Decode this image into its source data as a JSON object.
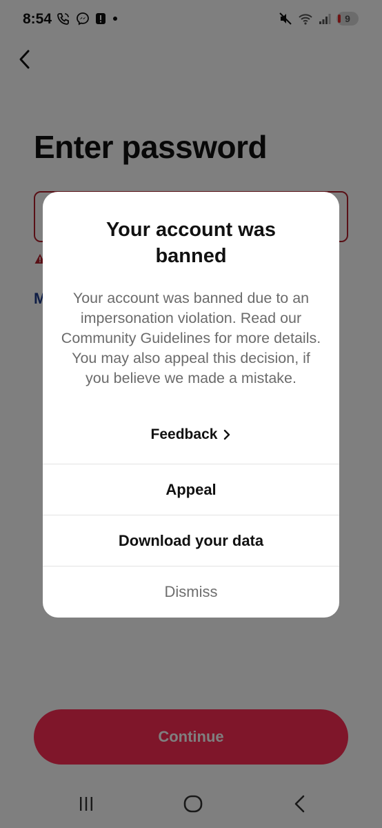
{
  "status_bar": {
    "time": "8:54",
    "battery": "9"
  },
  "page": {
    "title": "Enter password",
    "link_stub": "M",
    "continue_label": "Continue"
  },
  "modal": {
    "title_line1": "Your account was",
    "title_line2": "banned",
    "body": "Your account was banned due to an impersonation violation. Read our Community Guidelines for more details. You may also appeal this decision, if you believe we made a mistake.",
    "feedback_label": "Feedback",
    "appeal_label": "Appeal",
    "download_label": "Download your data",
    "dismiss_label": "Dismiss"
  },
  "colors": {
    "accent": "#fe2c55",
    "error": "#b3202c"
  }
}
